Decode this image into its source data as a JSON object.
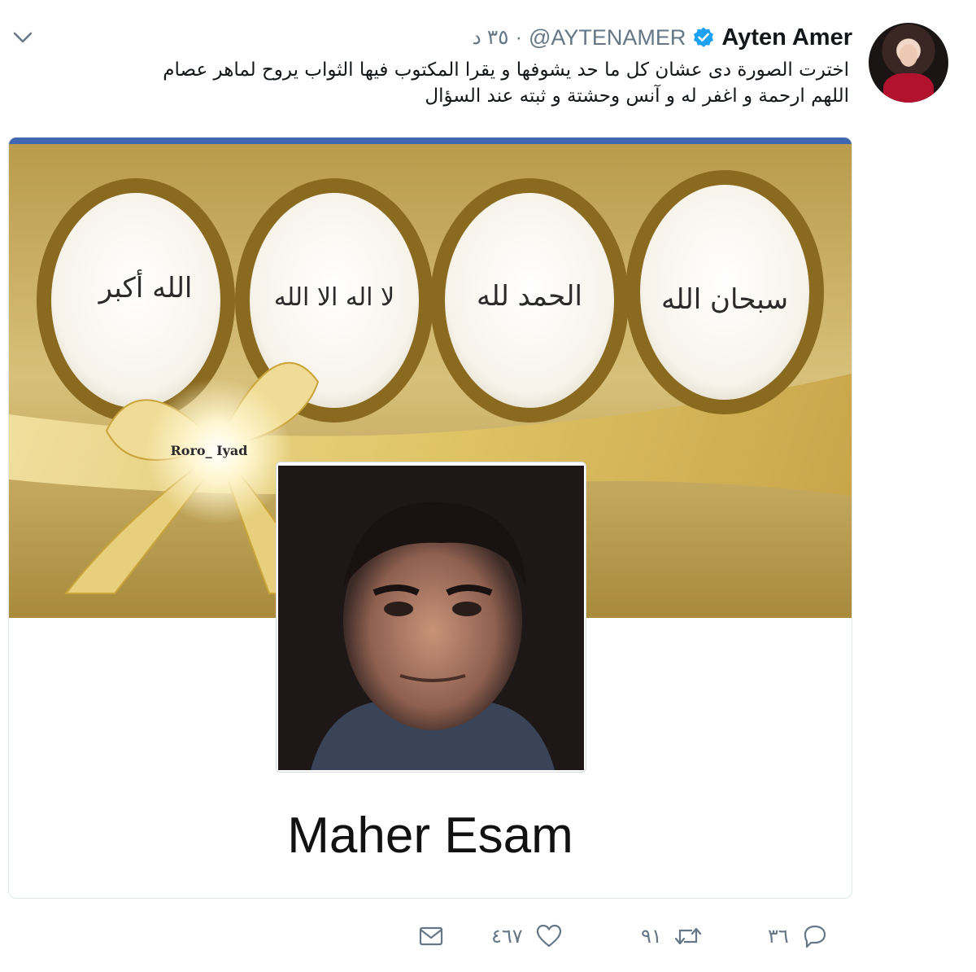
{
  "tweet": {
    "author_name": "Ayten Amer",
    "handle": "@AYTENAMER",
    "time": "٣٥ د",
    "separator": "·",
    "text_line1": "اخترت الصورة دى عشان كل ما حد يشوفها و يقرا المكتوب فيها الثواب يروح لماهر عصام",
    "text_line2": "اللهم ارحمة و اغفر له و آنس وحشتة و ثبته عند السؤال"
  },
  "card": {
    "ovals": [
      "سبحان الله",
      "الحمد لله",
      "لا اله الا الله",
      "الله أكبر"
    ],
    "watermark": "Roro_ Iyad",
    "profile_name": "Maher Esam"
  },
  "actions": {
    "replies": "٣٦",
    "retweets": "٩١",
    "likes": "٤٦٧"
  },
  "colors": {
    "text_primary": "#14171a",
    "text_secondary": "#657786",
    "verified_blue": "#1da1f2",
    "gold": "#c9a43a",
    "border": "#e1e8ed"
  },
  "icons": [
    "chevron-down-icon",
    "verified-badge-icon",
    "reply-icon",
    "retweet-icon",
    "like-icon",
    "direct-message-icon"
  ]
}
